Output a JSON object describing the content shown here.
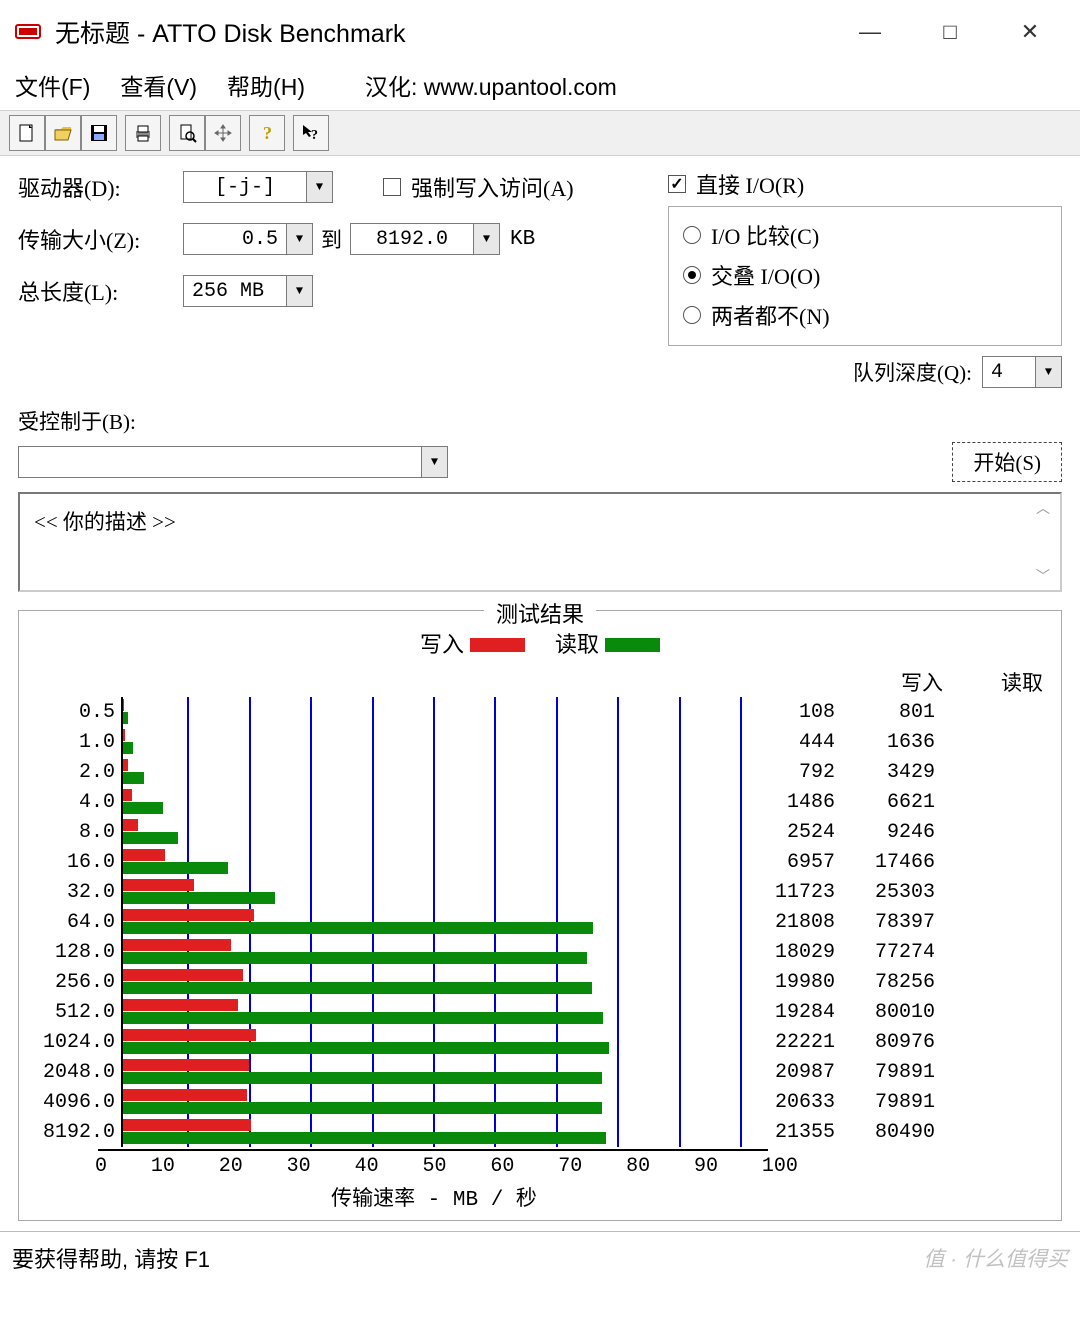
{
  "window": {
    "title": "无标题 - ATTO Disk Benchmark"
  },
  "menu": {
    "file": "文件(F)",
    "view": "查看(V)",
    "help": "帮助(H)",
    "credit": "汉化: www.upantool.com"
  },
  "settings": {
    "drive_label": "驱动器(D):",
    "drive_value": "[-j-]",
    "transfer_label": "传输大小(Z):",
    "transfer_from": "0.5",
    "to_label": "到",
    "transfer_to": "8192.0",
    "unit": "KB",
    "length_label": "总长度(L):",
    "length_value": "256 MB",
    "force_write": "强制写入访问(A)",
    "direct_io": "直接 I/O(R)",
    "io_compare": "I/O 比较(C)",
    "overlapped": "交叠 I/O(O)",
    "neither": "两者都不(N)",
    "queue_label": "队列深度(Q):",
    "queue_value": "4",
    "controlled_label": "受控制于(B):",
    "start_btn": "开始(S)"
  },
  "description": "<<  你的描述   >>",
  "results": {
    "title": "测试结果",
    "legend_write": "写入",
    "legend_read": "读取",
    "col_write": "写入",
    "col_read": "读取",
    "xlabel": "传输速率 - MB / 秒",
    "xmax": 100
  },
  "chart_data": {
    "type": "bar",
    "xlabel": "传输速率 - MB / 秒",
    "xlim": [
      0,
      100
    ],
    "xticks": [
      0,
      10,
      20,
      30,
      40,
      50,
      60,
      70,
      80,
      90,
      100
    ],
    "series_names": [
      "写入",
      "读取"
    ],
    "value_unit": "KB/s",
    "rows": [
      {
        "size": "0.5",
        "write_kbs": 108,
        "read_kbs": 801,
        "write_mbs": 0.1,
        "read_mbs": 0.8
      },
      {
        "size": "1.0",
        "write_kbs": 444,
        "read_kbs": 1636,
        "write_mbs": 0.4,
        "read_mbs": 1.6
      },
      {
        "size": "2.0",
        "write_kbs": 792,
        "read_kbs": 3429,
        "write_mbs": 0.8,
        "read_mbs": 3.4
      },
      {
        "size": "4.0",
        "write_kbs": 1486,
        "read_kbs": 6621,
        "write_mbs": 1.5,
        "read_mbs": 6.5
      },
      {
        "size": "8.0",
        "write_kbs": 2524,
        "read_kbs": 9246,
        "write_mbs": 2.5,
        "read_mbs": 9.0
      },
      {
        "size": "16.0",
        "write_kbs": 6957,
        "read_kbs": 17466,
        "write_mbs": 6.8,
        "read_mbs": 17.1
      },
      {
        "size": "32.0",
        "write_kbs": 11723,
        "read_kbs": 25303,
        "write_mbs": 11.5,
        "read_mbs": 24.7
      },
      {
        "size": "64.0",
        "write_kbs": 21808,
        "read_kbs": 78397,
        "write_mbs": 21.3,
        "read_mbs": 76.6
      },
      {
        "size": "128.0",
        "write_kbs": 18029,
        "read_kbs": 77274,
        "write_mbs": 17.6,
        "read_mbs": 75.5
      },
      {
        "size": "256.0",
        "write_kbs": 19980,
        "read_kbs": 78256,
        "write_mbs": 19.5,
        "read_mbs": 76.4
      },
      {
        "size": "512.0",
        "write_kbs": 19284,
        "read_kbs": 80010,
        "write_mbs": 18.8,
        "read_mbs": 78.1
      },
      {
        "size": "1024.0",
        "write_kbs": 22221,
        "read_kbs": 80976,
        "write_mbs": 21.7,
        "read_mbs": 79.1
      },
      {
        "size": "2048.0",
        "write_kbs": 20987,
        "read_kbs": 79891,
        "write_mbs": 20.5,
        "read_mbs": 78.0
      },
      {
        "size": "4096.0",
        "write_kbs": 20633,
        "read_kbs": 79891,
        "write_mbs": 20.2,
        "read_mbs": 78.0
      },
      {
        "size": "8192.0",
        "write_kbs": 21355,
        "read_kbs": 80490,
        "write_mbs": 20.9,
        "read_mbs": 78.6
      }
    ]
  },
  "status": "要获得帮助, 请按 F1",
  "watermark": "值 · 什么值得买"
}
